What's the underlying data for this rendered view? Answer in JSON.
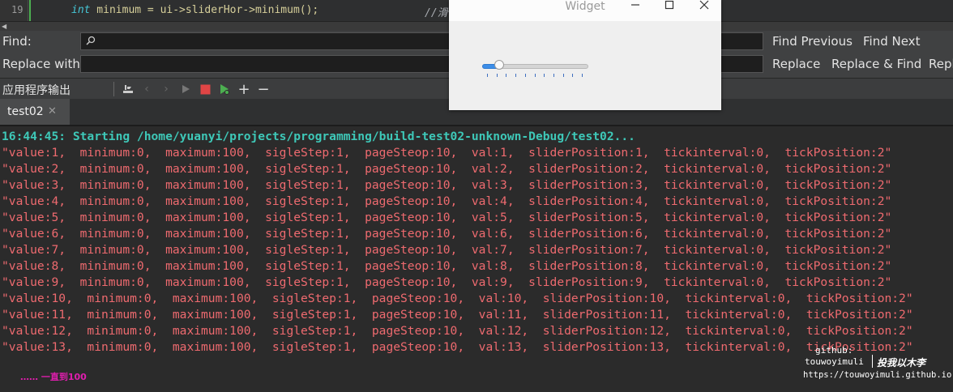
{
  "editor": {
    "line_number": "19",
    "code_keyword": "int",
    "code_rest": " minimum = ui->sliderHor->minimum();",
    "comment": "//滑"
  },
  "find_bar": {
    "find_label": "Find:",
    "replace_label": "Replace with:",
    "find_value": "",
    "replace_value": "",
    "find_previous": "Find Previous",
    "find_next": "Find Next",
    "replace": "Replace",
    "replace_find": "Replace & Find",
    "replace_all_partial": "Repl"
  },
  "output_pane": {
    "title": "应用程序输出",
    "tab_label": "test02",
    "start_line": "16:44:45: Starting /home/yuanyi/projects/programming/build-test02-unknown-Debug/test02...",
    "lines": [
      "\"value:1,  minimum:0,  maximum:100,  sigleStep:1,  pageSteop:10,  val:1,  sliderPosition:1,  tickinterval:0,  tickPosition:2\"",
      "\"value:2,  minimum:0,  maximum:100,  sigleStep:1,  pageSteop:10,  val:2,  sliderPosition:2,  tickinterval:0,  tickPosition:2\"",
      "\"value:3,  minimum:0,  maximum:100,  sigleStep:1,  pageSteop:10,  val:3,  sliderPosition:3,  tickinterval:0,  tickPosition:2\"",
      "\"value:4,  minimum:0,  maximum:100,  sigleStep:1,  pageSteop:10,  val:4,  sliderPosition:4,  tickinterval:0,  tickPosition:2\"",
      "\"value:5,  minimum:0,  maximum:100,  sigleStep:1,  pageSteop:10,  val:5,  sliderPosition:5,  tickinterval:0,  tickPosition:2\"",
      "\"value:6,  minimum:0,  maximum:100,  sigleStep:1,  pageSteop:10,  val:6,  sliderPosition:6,  tickinterval:0,  tickPosition:2\"",
      "\"value:7,  minimum:0,  maximum:100,  sigleStep:1,  pageSteop:10,  val:7,  sliderPosition:7,  tickinterval:0,  tickPosition:2\"",
      "\"value:8,  minimum:0,  maximum:100,  sigleStep:1,  pageSteop:10,  val:8,  sliderPosition:8,  tickinterval:0,  tickPosition:2\"",
      "\"value:9,  minimum:0,  maximum:100,  sigleStep:1,  pageSteop:10,  val:9,  sliderPosition:9,  tickinterval:0,  tickPosition:2\"",
      "\"value:10,  minimum:0,  maximum:100,  sigleStep:1,  pageSteop:10,  val:10,  sliderPosition:10,  tickinterval:0,  tickPosition:2\"",
      "\"value:11,  minimum:0,  maximum:100,  sigleStep:1,  pageSteop:10,  val:11,  sliderPosition:11,  tickinterval:0,  tickPosition:2\"",
      "\"value:12,  minimum:0,  maximum:100,  sigleStep:1,  pageSteop:10,  val:12,  sliderPosition:12,  tickinterval:0,  tickPosition:2\"",
      "\"value:13,  minimum:0,  maximum:100,  sigleStep:1,  pageSteop:10,  val:13,  sliderPosition:13,  tickinterval:0,  tickPosition:2\""
    ],
    "note": "…… 一直到100",
    "colors": {
      "start": "#3ec8b8",
      "lines": "#ee6a6f",
      "note": "#e01eae"
    }
  },
  "toolbar_icons": [
    "attach-to-editor-icon",
    "previous-icon",
    "next-icon",
    "run-icon",
    "stop-icon",
    "debug-run-icon",
    "zoom-in-icon",
    "zoom-out-icon"
  ],
  "watermark": {
    "github": "github:",
    "user": "touwoyimuli",
    "chinese": "投我以木李",
    "url": "https://touwoyimuli.github.io"
  },
  "widget": {
    "title": "Widget",
    "slider": {
      "minimum": 0,
      "maximum": 100,
      "value": 13,
      "tick_count": 11
    }
  }
}
